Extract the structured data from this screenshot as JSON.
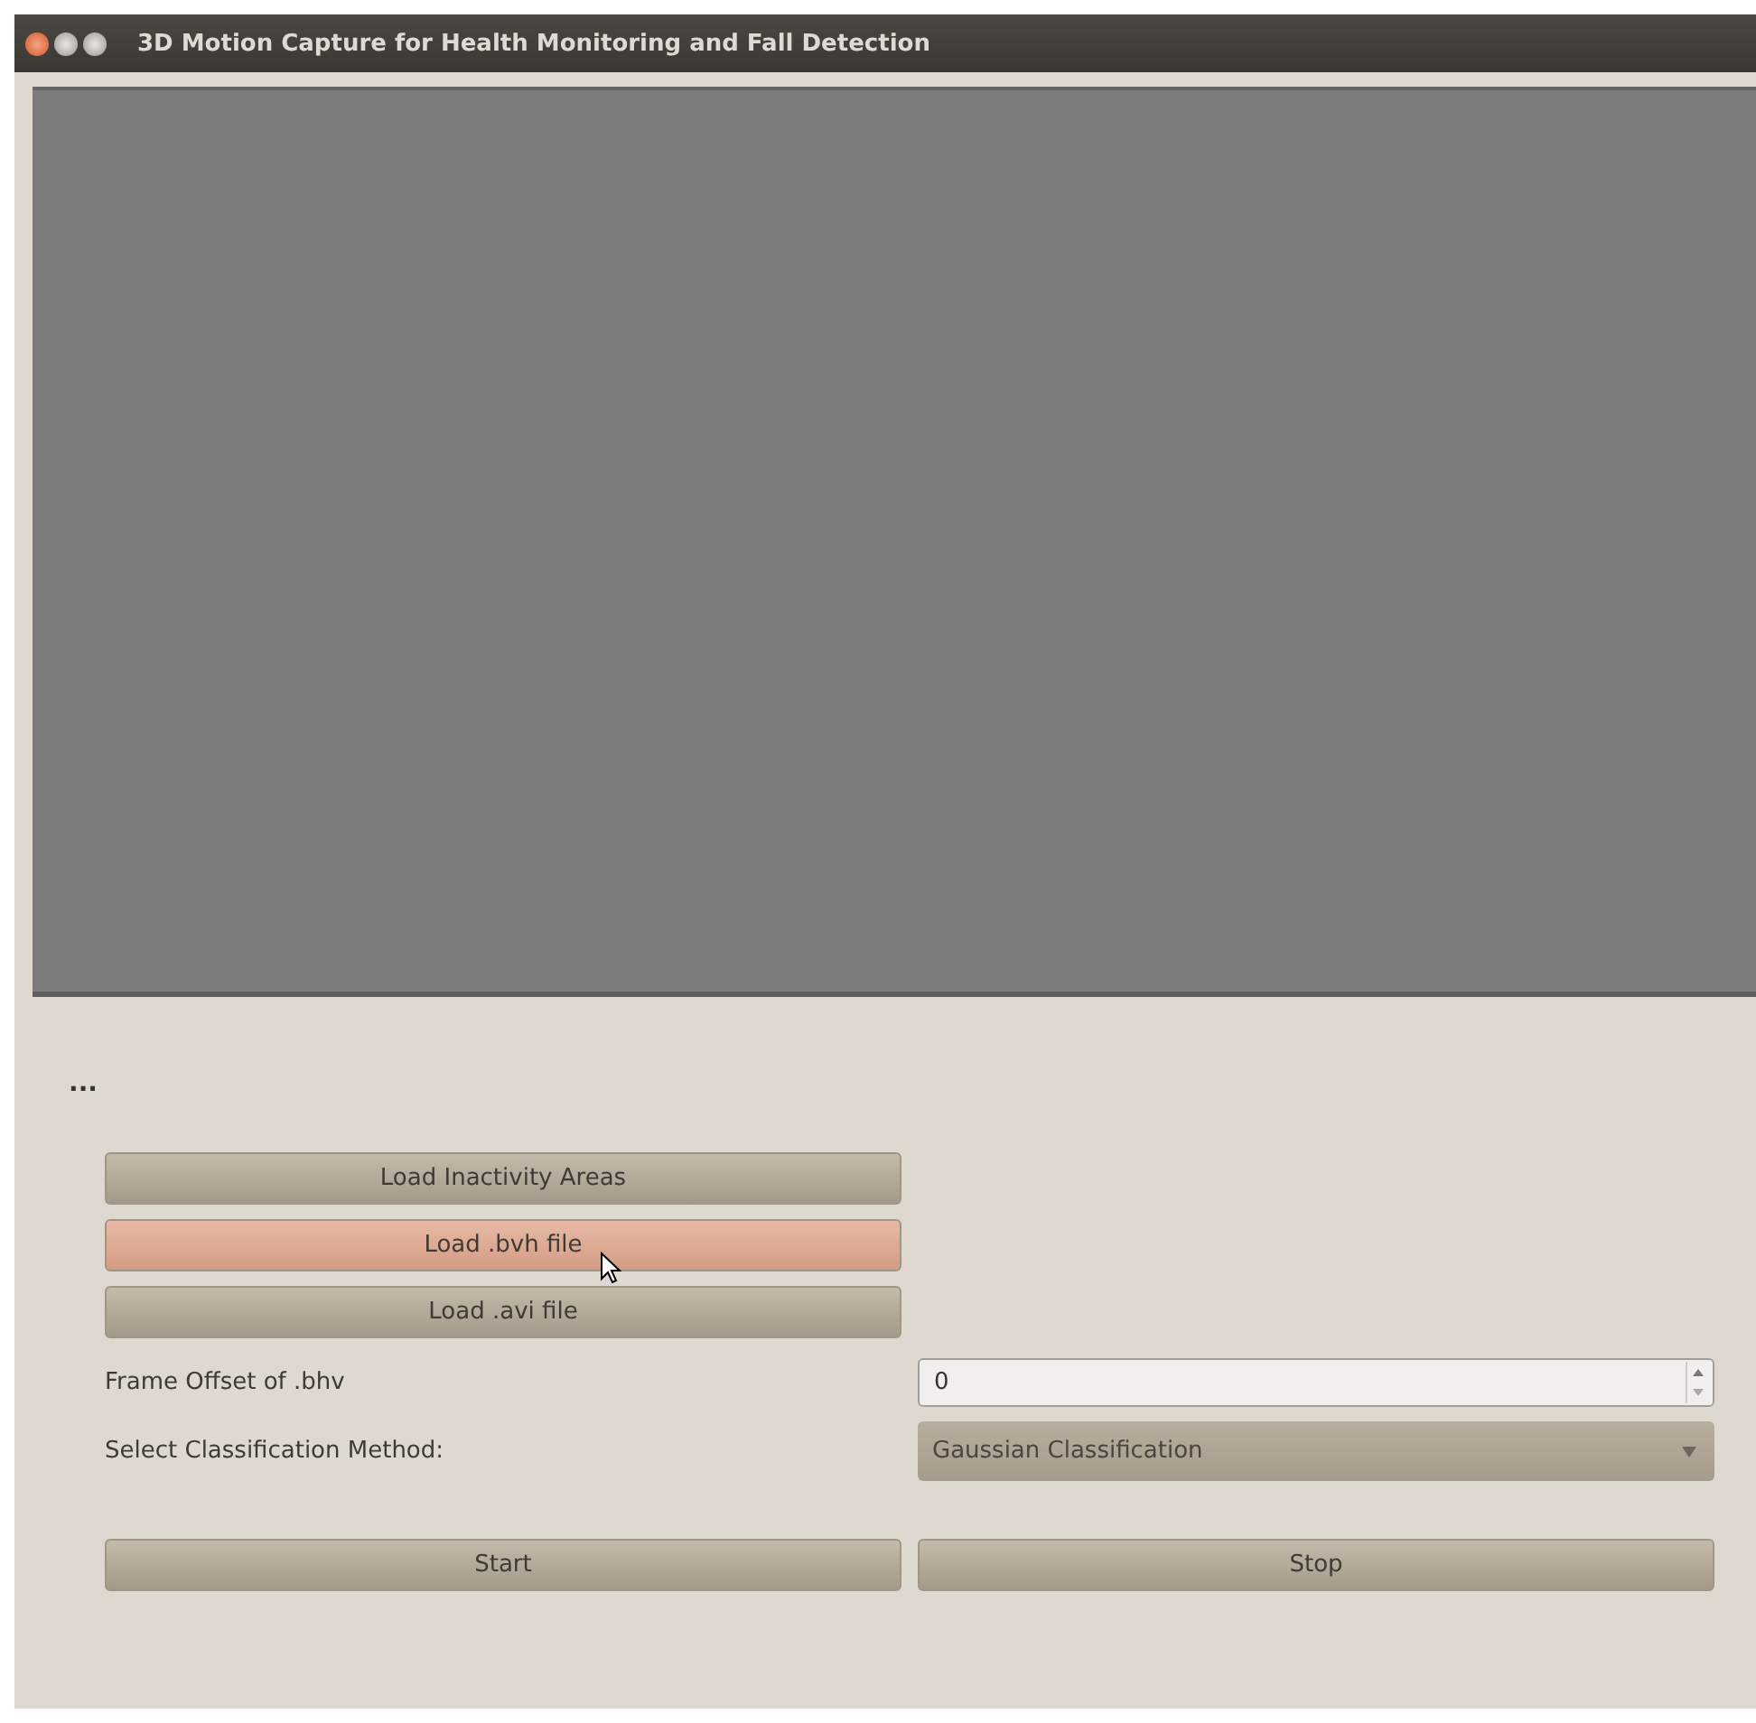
{
  "window": {
    "title": "3D Motion Capture for Health Monitoring and Fall Detection"
  },
  "status_text": "...",
  "load_buttons": [
    {
      "label": "Load Inactivity Areas",
      "hovered": false
    },
    {
      "label": "Load .bvh file",
      "hovered": true
    },
    {
      "label": "Load .avi file",
      "hovered": false
    }
  ],
  "frame_offset": {
    "label": "Frame Offset of .bhv",
    "value": "0"
  },
  "classification": {
    "label": "Select Classification Method:",
    "value": "Gaussian Classification"
  },
  "actions": [
    "Start",
    "Stop"
  ]
}
